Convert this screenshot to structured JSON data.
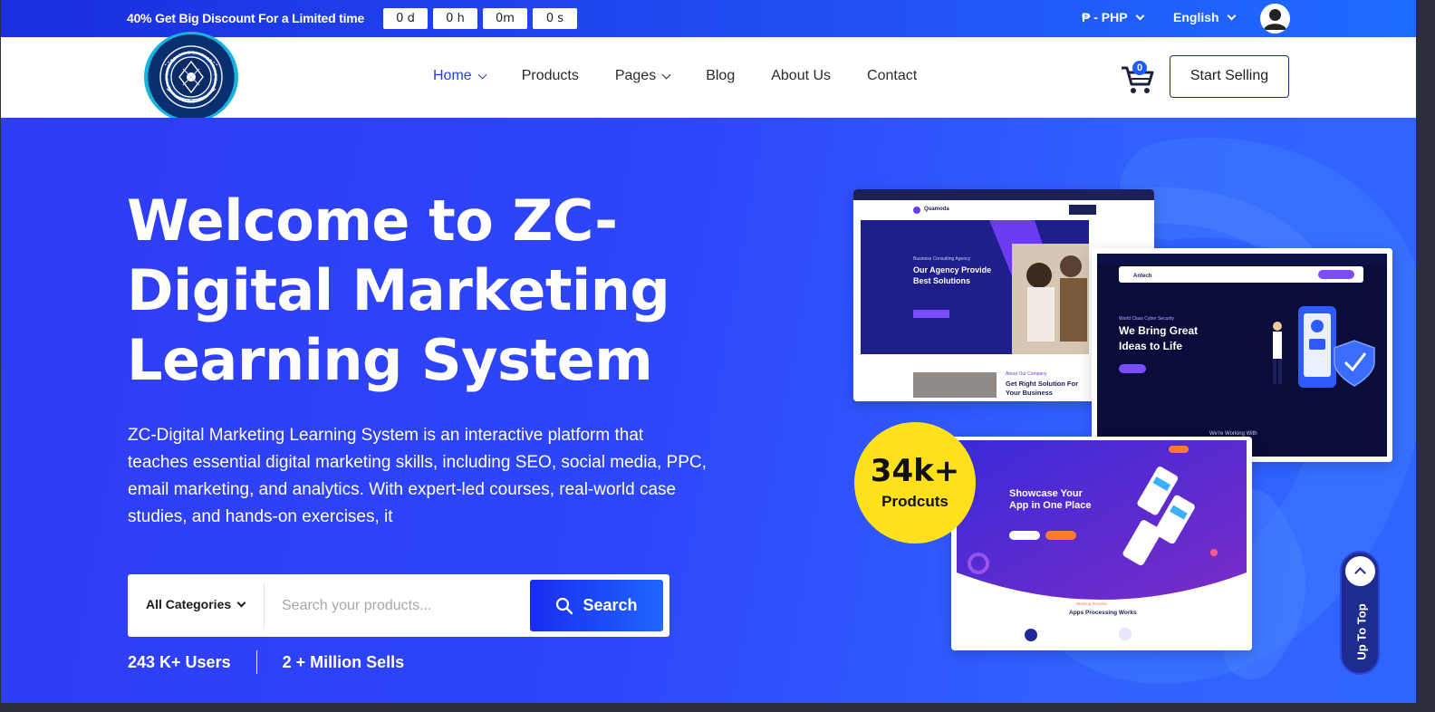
{
  "topbar": {
    "promo_bold": "40%",
    "promo_text": "Get Big Discount For a Limited time",
    "timer": [
      "0 d",
      "0 h",
      "0m",
      "0 s"
    ],
    "currency": "₱ - PHP",
    "language": "English"
  },
  "nav": {
    "items": [
      {
        "label": "Home",
        "dropdown": true,
        "active": true
      },
      {
        "label": "Products",
        "dropdown": false
      },
      {
        "label": "Pages",
        "dropdown": true
      },
      {
        "label": "Blog",
        "dropdown": false
      },
      {
        "label": "About Us",
        "dropdown": false
      },
      {
        "label": "Contact",
        "dropdown": false
      }
    ],
    "cart_count": "0",
    "start_selling": "Start Selling"
  },
  "hero": {
    "title": "Welcome to ZC-Digital Marketing Learning System",
    "description": "ZC-Digital Marketing Learning System is an interactive platform that teaches essential digital marketing skills, including SEO, social media, PPC, email marketing, and analytics. With expert-led courses, real-world case studies, and hands-on exercises, it",
    "search": {
      "category": "All Categories",
      "placeholder": "Search your products...",
      "button": "Search"
    },
    "stats": {
      "users": "243 K+ Users",
      "sells": "2 + Million Sells"
    },
    "badge": {
      "number": "34k+",
      "label": "Prodcuts"
    }
  },
  "previews": {
    "one": {
      "brand": "Quamoda",
      "kicker": "Business Consulting Agency",
      "headline": "Our Agency Provide Best Solutions",
      "sub_kicker": "About Our Company",
      "sub_headline": "Get Right Solution For Your Business"
    },
    "two": {
      "brand": "Antech",
      "kicker": "World Class Cyber Security",
      "headline": "We Bring Great Ideas to Life",
      "footer": "We're Working With"
    },
    "three": {
      "headline": "Showcase Your App in One Place",
      "kicker": "Working Process",
      "footer": "Apps Processing Works"
    }
  },
  "up_to_top": "Up To Top",
  "colors": {
    "brand_blue": "#2e3cf5",
    "badge_yellow": "#ffe11b",
    "nav_active": "#2240d8"
  }
}
